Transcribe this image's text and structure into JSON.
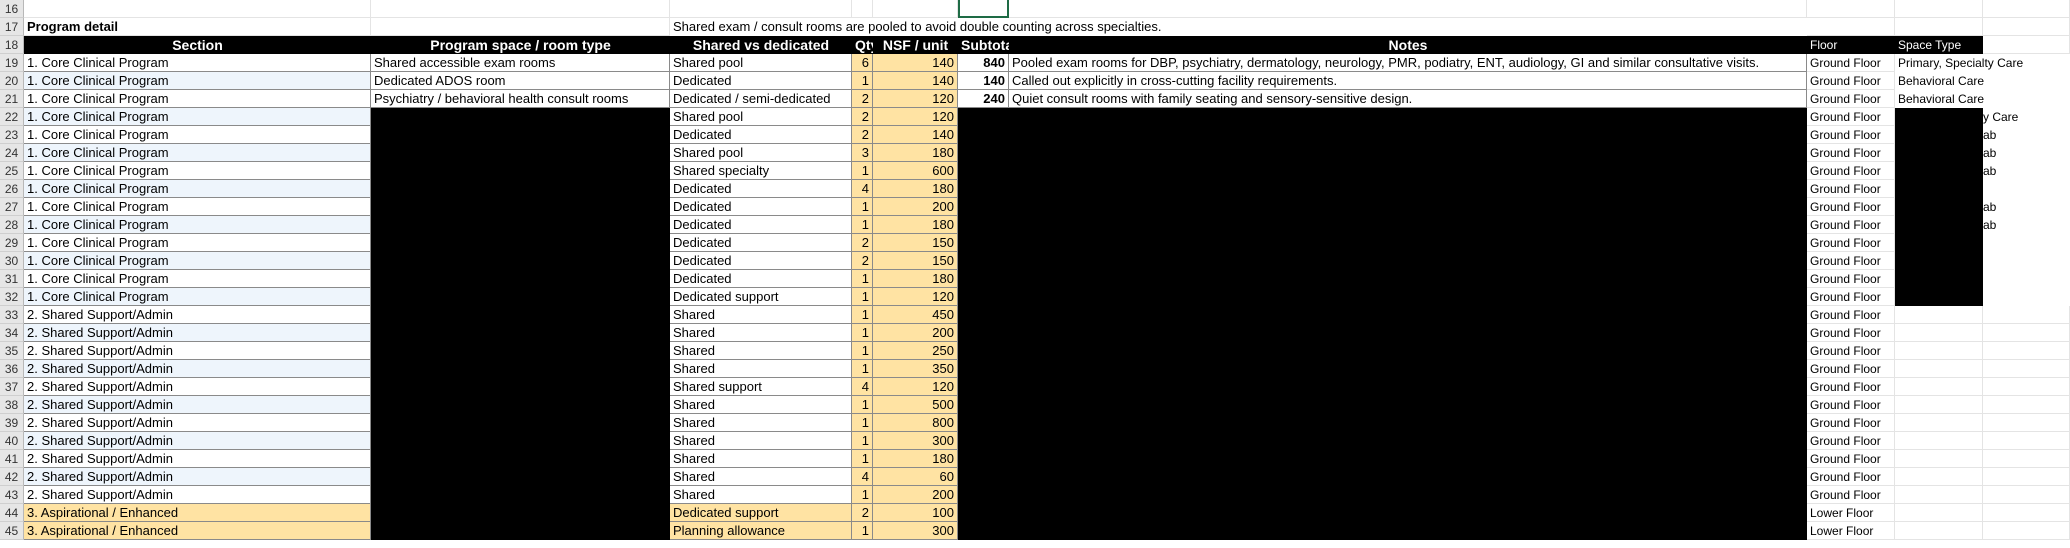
{
  "program_title": "Program detail",
  "pooling_note": "Shared exam / consult rooms are pooled to avoid double counting across specialties.",
  "columns": {
    "section": "Section",
    "space": "Program space / room type",
    "shared": "Shared vs dedicated",
    "qty": "Qty",
    "nsf": "NSF / unit",
    "subtotal": "Subtotal NSF",
    "notes": "Notes",
    "floor": "Floor",
    "type": "Space Type"
  },
  "rows": [
    {
      "n": "16",
      "section": "",
      "space": "",
      "shared": "",
      "qty": "",
      "nsf": "",
      "subtotal": "",
      "notes": "",
      "floor": "",
      "type": ""
    },
    {
      "n": "17",
      "section": "",
      "space": "",
      "shared": "",
      "qty": "",
      "nsf": "",
      "subtotal": "",
      "notes": "",
      "floor": "",
      "type": ""
    },
    {
      "n": "18",
      "section": "",
      "space": "",
      "shared": "",
      "qty": "",
      "nsf": "",
      "subtotal": "",
      "notes": "",
      "floor": "",
      "type": ""
    },
    {
      "n": "19",
      "section": "1. Core Clinical Program",
      "space": "Shared accessible exam rooms",
      "shared": "Shared pool",
      "qty": "6",
      "nsf": "140",
      "subtotal": "840",
      "notes": "Pooled exam rooms for DBP, psychiatry, dermatology, neurology, PMR, podiatry, ENT, audiology, GI and similar consultative visits.",
      "floor": "Ground Floor",
      "type": "Primary, Specialty Care"
    },
    {
      "n": "20",
      "section": "1. Core Clinical Program",
      "space": "Dedicated ADOS room",
      "shared": "Dedicated",
      "qty": "1",
      "nsf": "140",
      "subtotal": "140",
      "notes": "Called out explicitly in cross-cutting facility requirements.",
      "floor": "Ground Floor",
      "type": "Behavioral Care"
    },
    {
      "n": "21",
      "section": "1. Core Clinical Program",
      "space": "Psychiatry / behavioral health consult rooms",
      "shared": "Dedicated / semi-dedicated",
      "qty": "2",
      "nsf": "120",
      "subtotal": "240",
      "notes": "Quiet consult rooms with family seating and sensory-sensitive design.",
      "floor": "Ground Floor",
      "type": "Behavioral Care"
    },
    {
      "n": "22",
      "section": "1. Core Clinical Program",
      "space": "",
      "shared": "Shared pool",
      "qty": "2",
      "nsf": "120",
      "subtotal": "",
      "notes": "",
      "floor": "Ground Floor",
      "type": "y Care"
    },
    {
      "n": "23",
      "section": "1. Core Clinical Program",
      "space": "",
      "shared": "Dedicated",
      "qty": "2",
      "nsf": "140",
      "subtotal": "",
      "notes": "",
      "floor": "Ground Floor",
      "type": "ab"
    },
    {
      "n": "24",
      "section": "1. Core Clinical Program",
      "space": "",
      "shared": "Shared pool",
      "qty": "3",
      "nsf": "180",
      "subtotal": "",
      "notes": "",
      "floor": "Ground Floor",
      "type": "ab"
    },
    {
      "n": "25",
      "section": "1. Core Clinical Program",
      "space": "",
      "shared": "Shared specialty",
      "qty": "1",
      "nsf": "600",
      "subtotal": "",
      "notes": "",
      "floor": "Ground Floor",
      "type": "ab"
    },
    {
      "n": "26",
      "section": "1. Core Clinical Program",
      "space": "",
      "shared": "Dedicated",
      "qty": "4",
      "nsf": "180",
      "subtotal": "",
      "notes": "",
      "floor": "Ground Floor",
      "type": ""
    },
    {
      "n": "27",
      "section": "1. Core Clinical Program",
      "space": "",
      "shared": "Dedicated",
      "qty": "1",
      "nsf": "200",
      "subtotal": "",
      "notes": "",
      "floor": "Ground Floor",
      "type": "ab"
    },
    {
      "n": "28",
      "section": "1. Core Clinical Program",
      "space": "",
      "shared": "Dedicated",
      "qty": "1",
      "nsf": "180",
      "subtotal": "",
      "notes": "",
      "floor": "Ground Floor",
      "type": "ab"
    },
    {
      "n": "29",
      "section": "1. Core Clinical Program",
      "space": "",
      "shared": "Dedicated",
      "qty": "2",
      "nsf": "150",
      "subtotal": "",
      "notes": "",
      "floor": "Ground Floor",
      "type": ""
    },
    {
      "n": "30",
      "section": "1. Core Clinical Program",
      "space": "",
      "shared": "Dedicated",
      "qty": "2",
      "nsf": "150",
      "subtotal": "",
      "notes": "",
      "floor": "Ground Floor",
      "type": ""
    },
    {
      "n": "31",
      "section": "1. Core Clinical Program",
      "space": "",
      "shared": "Dedicated",
      "qty": "1",
      "nsf": "180",
      "subtotal": "",
      "notes": "",
      "floor": "Ground Floor",
      "type": ""
    },
    {
      "n": "32",
      "section": "1. Core Clinical Program",
      "space": "",
      "shared": "Dedicated support",
      "qty": "1",
      "nsf": "120",
      "subtotal": "",
      "notes": "",
      "floor": "Ground Floor",
      "type": ""
    },
    {
      "n": "33",
      "section": "2. Shared Support/Admin",
      "space": "",
      "shared": "Shared",
      "qty": "1",
      "nsf": "450",
      "subtotal": "",
      "notes": "",
      "floor": "Ground Floor",
      "type": ""
    },
    {
      "n": "34",
      "section": "2. Shared Support/Admin",
      "space": "",
      "shared": "Shared",
      "qty": "1",
      "nsf": "200",
      "subtotal": "",
      "notes": "",
      "floor": "Ground Floor",
      "type": ""
    },
    {
      "n": "35",
      "section": "2. Shared Support/Admin",
      "space": "",
      "shared": "Shared",
      "qty": "1",
      "nsf": "250",
      "subtotal": "",
      "notes": "",
      "floor": "Ground Floor",
      "type": ""
    },
    {
      "n": "36",
      "section": "2. Shared Support/Admin",
      "space": "",
      "shared": "Shared",
      "qty": "1",
      "nsf": "350",
      "subtotal": "",
      "notes": "",
      "floor": "Ground Floor",
      "type": ""
    },
    {
      "n": "37",
      "section": "2. Shared Support/Admin",
      "space": "",
      "shared": "Shared support",
      "qty": "4",
      "nsf": "120",
      "subtotal": "",
      "notes": "",
      "floor": "Ground Floor",
      "type": ""
    },
    {
      "n": "38",
      "section": "2. Shared Support/Admin",
      "space": "",
      "shared": "Shared",
      "qty": "1",
      "nsf": "500",
      "subtotal": "",
      "notes": "",
      "floor": "Ground Floor",
      "type": ""
    },
    {
      "n": "39",
      "section": "2. Shared Support/Admin",
      "space": "",
      "shared": "Shared",
      "qty": "1",
      "nsf": "800",
      "subtotal": "",
      "notes": "",
      "floor": "Ground Floor",
      "type": ""
    },
    {
      "n": "40",
      "section": "2. Shared Support/Admin",
      "space": "",
      "shared": "Shared",
      "qty": "1",
      "nsf": "300",
      "subtotal": "",
      "notes": "",
      "floor": "Ground Floor",
      "type": ""
    },
    {
      "n": "41",
      "section": "2. Shared Support/Admin",
      "space": "",
      "shared": "Shared",
      "qty": "1",
      "nsf": "180",
      "subtotal": "",
      "notes": "",
      "floor": "Ground Floor",
      "type": ""
    },
    {
      "n": "42",
      "section": "2. Shared Support/Admin",
      "space": "",
      "shared": "Shared",
      "qty": "4",
      "nsf": "60",
      "subtotal": "",
      "notes": "",
      "floor": "Ground Floor",
      "type": ""
    },
    {
      "n": "43",
      "section": "2. Shared Support/Admin",
      "space": "",
      "shared": "Shared",
      "qty": "1",
      "nsf": "200",
      "subtotal": "",
      "notes": "",
      "floor": "Ground Floor",
      "type": ""
    },
    {
      "n": "44",
      "section": "3. Aspirational / Enhanced",
      "space": "",
      "shared": "Dedicated support",
      "qty": "2",
      "nsf": "100",
      "subtotal": "",
      "notes": "",
      "floor": "Lower Floor",
      "type": ""
    },
    {
      "n": "45",
      "section": "3. Aspirational / Enhanced",
      "space": "",
      "shared": "Planning allowance",
      "qty": "1",
      "nsf": "300",
      "subtotal": "",
      "notes": "",
      "floor": "Lower Floor",
      "type": ""
    }
  ]
}
